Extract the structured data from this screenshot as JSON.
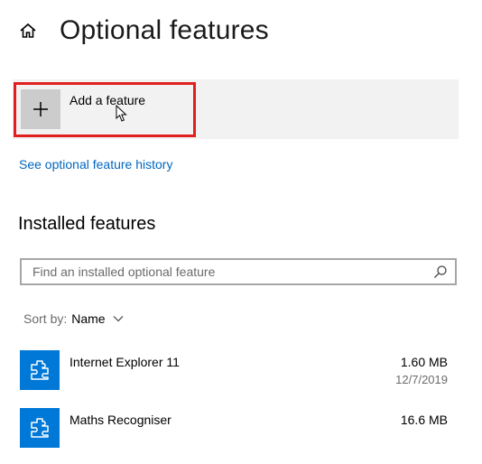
{
  "header": {
    "home_icon": "home-icon",
    "title": "Optional features"
  },
  "add_feature": {
    "label": "Add a feature",
    "icon": "plus-icon"
  },
  "history_link": "See optional feature history",
  "installed": {
    "heading": "Installed features",
    "search_placeholder": "Find an installed optional feature",
    "search_icon": "search-icon",
    "sort_label": "Sort by:",
    "sort_value": "Name",
    "items": [
      {
        "name": "Internet Explorer 11",
        "size": "1.60 MB",
        "date": "12/7/2019",
        "icon": "puzzle-icon"
      },
      {
        "name": "Maths Recogniser",
        "size": "16.6 MB",
        "icon": "puzzle-icon"
      }
    ]
  },
  "colors": {
    "accent": "#0067c0",
    "icon_tile": "#0078d7",
    "highlight": "#e0201e",
    "card_bg": "#f2f2f2"
  }
}
